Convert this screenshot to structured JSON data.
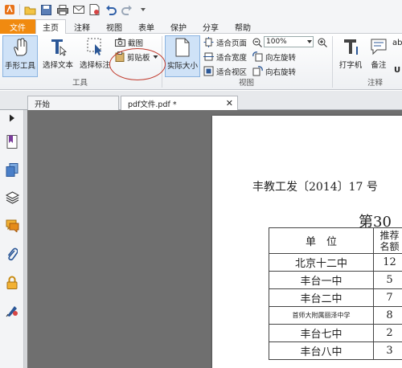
{
  "quick_access": {
    "icons": [
      "app-logo-icon",
      "open-folder-icon",
      "save-icon",
      "print-icon",
      "email-icon",
      "new-doc-icon",
      "undo-icon",
      "redo-icon",
      "customize-dropdown-icon"
    ]
  },
  "ribbon_tabs": [
    "文件",
    "主页",
    "注释",
    "视图",
    "表单",
    "保护",
    "分享",
    "帮助"
  ],
  "ribbon": {
    "tools_group_label": "工具",
    "view_group_label": "视图",
    "comment_group_label": "注释",
    "hand_tool": "手形工具",
    "select_text": "选择文本",
    "select_annotation": "选择标注",
    "screenshot": "截图",
    "clipboard": "剪贴板",
    "actual_size": "实际大小",
    "fit_page": "适合页面",
    "fit_width": "适合宽度",
    "fit_visible": "适合视区",
    "zoom_value": "100%",
    "rotate_left": "向左旋转",
    "rotate_right": "向右旋转",
    "typewriter": "打字机",
    "note": "备注",
    "highlight_partial": "ab",
    "underline_partial": "U"
  },
  "doc_tabs": [
    {
      "label": "开始"
    },
    {
      "label": "pdf文件.pdf *"
    }
  ],
  "document": {
    "heading": "丰教工发〔2014〕17 号",
    "page_heading": "第30",
    "table": {
      "headers": [
        "单　位",
        "推荐",
        "名额"
      ],
      "rows": [
        {
          "school": "北京十二中",
          "count": "12"
        },
        {
          "school": "丰台一中",
          "count": "5"
        },
        {
          "school": "丰台二中",
          "count": "7"
        },
        {
          "school": "首师大附属丽泽中学",
          "count": "8"
        },
        {
          "school": "丰台七中",
          "count": "2"
        },
        {
          "school": "丰台八中",
          "count": "3"
        }
      ]
    }
  },
  "colors": {
    "file_tab": "#f08a10",
    "selected_button": "#cfe2f7",
    "workspace": "#6f6f6f",
    "highlight_circle": "#c0392b"
  }
}
